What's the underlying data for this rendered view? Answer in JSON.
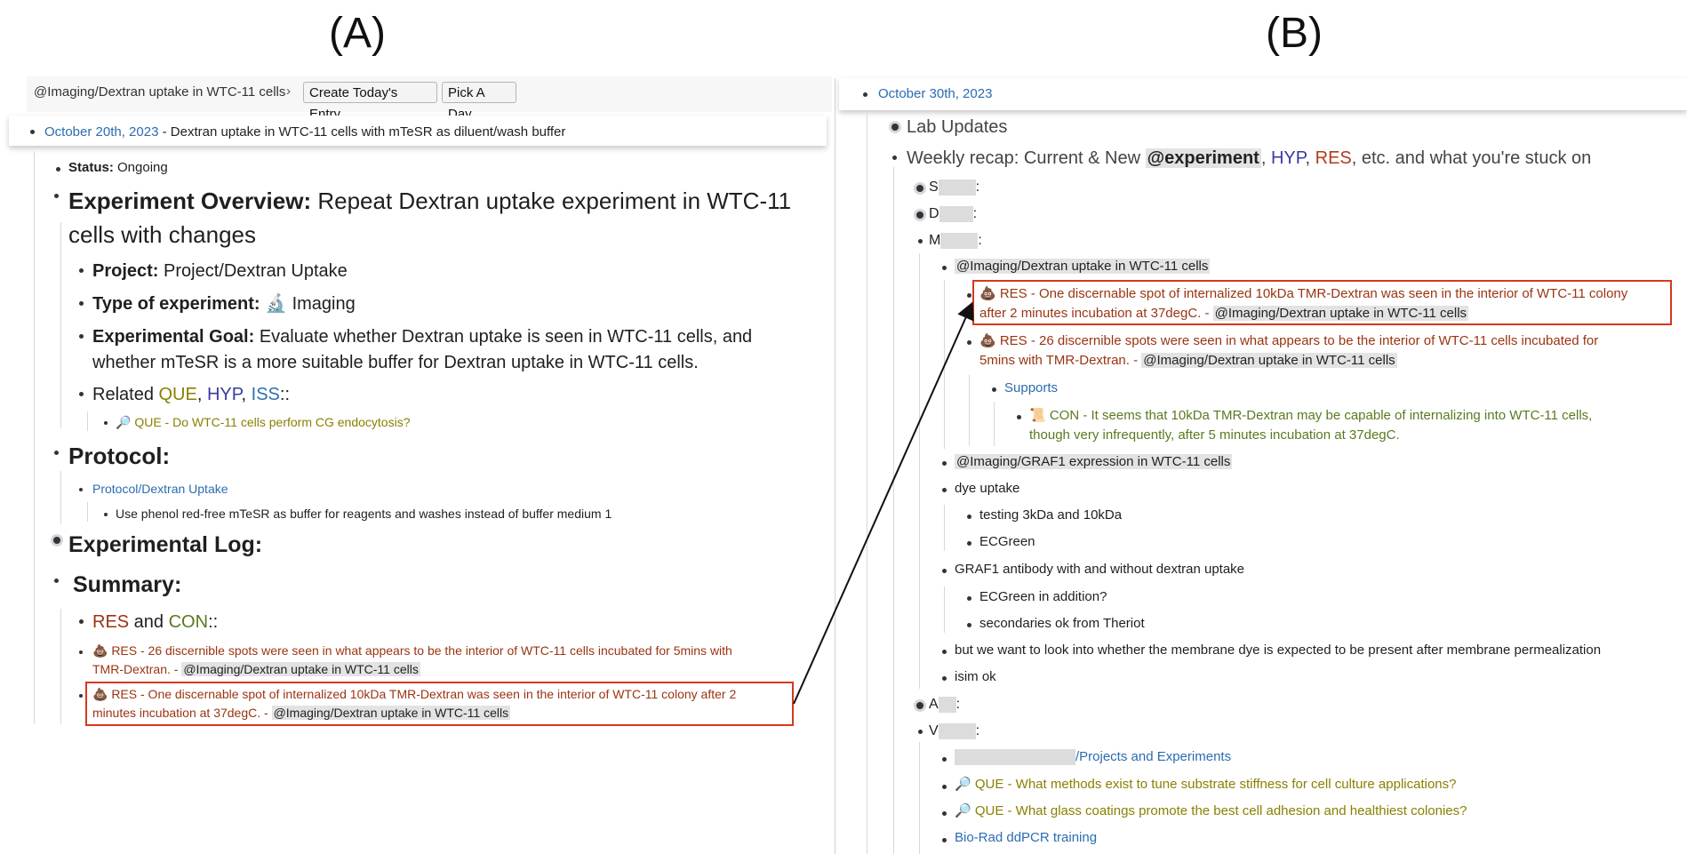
{
  "labels": {
    "a": "(A)",
    "b": "(B)"
  },
  "panel_a": {
    "breadcrumb": "@Imaging/Dextran uptake in WTC-11 cells",
    "create_btn": "Create Today's Entry",
    "pick_btn": "Pick A Day",
    "header_date": "October 20th, 2023",
    "header_rest": " - Dextran uptake in WTC-11 cells with mTeSR as diluent/wash buffer",
    "status_key": "Status:",
    "status_val": " Ongoing",
    "overview_key": "Experiment Overview:",
    "overview_val_1": " Repeat Dextran uptake experiment in WTC-11",
    "overview_val_2": "cells with changes",
    "project_key": "Project:",
    "project_val": " Project/Dextran Uptake",
    "type_key": "Type of experiment:",
    "type_val": " 🔬 Imaging",
    "goal_key": "Experimental Goal:",
    "goal_val_1": " Evaluate whether Dextran uptake is seen in WTC-11 cells, and",
    "goal_val_2": "whether mTeSR is a more suitable buffer for Dextran uptake in WTC-11 cells.",
    "related_prefix": "Related ",
    "related_que": "QUE",
    "related_hyp": "HYP",
    "related_iss": "ISS",
    "related_suffix": "::",
    "que_item": "🔎 QUE - Do WTC-11 cells perform CG endocytosis?",
    "protocol_heading": "Protocol:",
    "protocol_link": "Protocol/Dextran Uptake",
    "protocol_note": "Use phenol red-free mTeSR as buffer for reagents and washes instead of buffer medium 1",
    "log_heading": "Experimental Log:",
    "summary_heading": "Summary:",
    "res_label": "RES",
    "and_label": " and ",
    "con_label": "CON",
    "colons": "::",
    "res1_line1": "💩 RES - 26 discernible spots were seen in what appears to be the interior of WTC-11 cells incubated for 5mins with",
    "res1_line2": "TMR-Dextran. - ",
    "res1_ref": "@Imaging/Dextran uptake in WTC-11 cells",
    "res2_line1": "💩 RES - One discernable spot of internalized 10kDa TMR-Dextran was seen in the interior of WTC-11 colony after 2",
    "res2_line2": "minutes incubation at 37degC. - ",
    "res2_ref": "@Imaging/Dextran uptake in WTC-11 cells"
  },
  "panel_b": {
    "header_date": "October 30th, 2023",
    "lab_updates": "Lab Updates",
    "recap_1": "Weekly recap: Current & New ",
    "recap_exp": "@experiment",
    "recap_comma": ", ",
    "recap_hyp": "HYP",
    "recap_res": "RES",
    "recap_2": ", etc. and what you're stuck on",
    "s_initial": "S",
    "d_initial": "D",
    "m_initial": "M",
    "colon": ":",
    "imaging_ref": "@Imaging/Dextran uptake in WTC-11 cells",
    "res_a_line1": "💩 RES - One discernable spot of internalized 10kDa TMR-Dextran was seen in the interior of WTC-11 colony",
    "res_a_line2": "after 2 minutes incubation at 37degC. - ",
    "res_a_ref": "@Imaging/Dextran uptake in WTC-11 cells",
    "res_b_line1": "💩 RES - 26 discernible spots were seen in what appears to be the interior of WTC-11 cells incubated for",
    "res_b_line2": "5mins with TMR-Dextran. - ",
    "res_b_ref": "@Imaging/Dextran uptake in WTC-11 cells",
    "supports": "Supports",
    "con_line1": "📜 CON - It seems that 10kDa TMR-Dextran may be capable of internalizing into WTC-11 cells,",
    "con_line2": "though very infrequently, after 5 minutes incubation at 37degC.",
    "graf1_ref": "@Imaging/GRAF1 expression in WTC-11 cells",
    "dye_uptake": "dye uptake",
    "testing": "testing 3kDa and 10kDa",
    "ecgreen": "ECGreen",
    "graf1_antibody": "GRAF1 antibody with and without dextran uptake",
    "ecgreen_add": "ECGreen in addition?",
    "secondaries": "secondaries ok from Theriot",
    "membrane": "but we want to look into whether the membrane dye is expected to be present after membrane permealization",
    "isim": "isim ok",
    "a_initial": "A",
    "v_initial": "V",
    "projects": "/Projects and Experiments",
    "que1": "🔎 QUE - What methods exist to tune substrate stiffness for cell culture applications?",
    "que2": "🔎 QUE - What glass coatings promote the best cell adhesion and healthiest colonies?",
    "biorad": "Bio-Rad ddPCR training"
  },
  "colors": {
    "highlight_box": "#d6391c",
    "res": "#9a3412",
    "que": "#8a8000",
    "hyp": "#3a3aa6",
    "link": "#2b6cb0"
  }
}
